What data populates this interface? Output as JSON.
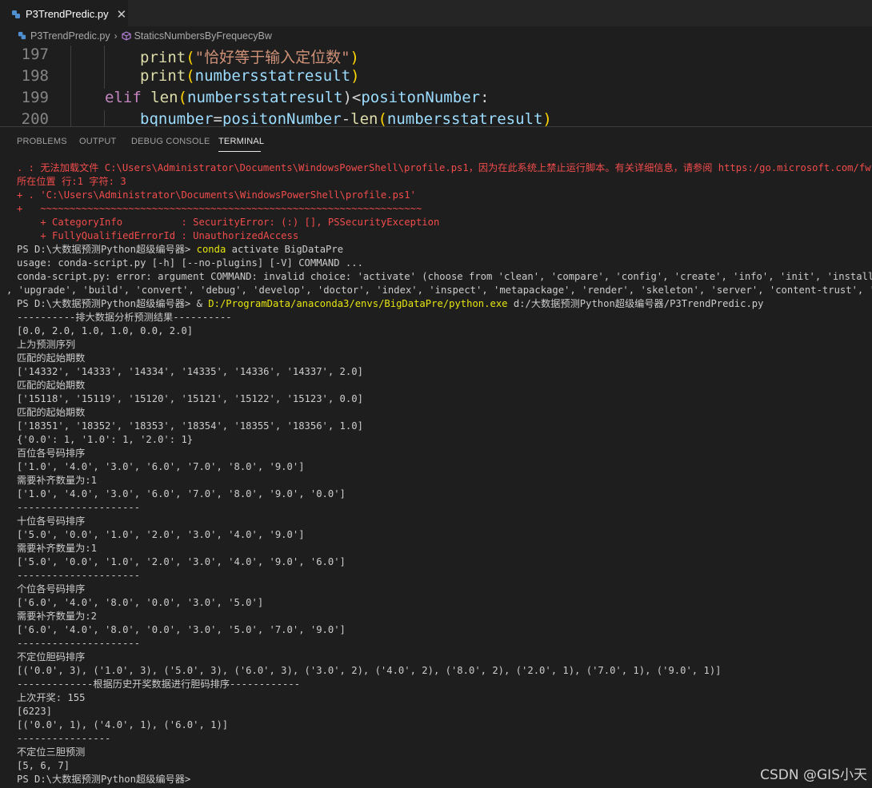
{
  "editor_tab": {
    "title": "P3TrendPredic.py"
  },
  "breadcrumb": {
    "file": "P3TrendPredic.py",
    "symbol": "StaticsNumbersByFrequecyBw"
  },
  "code_lines": [
    {
      "num": "197",
      "t1": "print",
      "t2": "(",
      "t3": "\"恰好等于输入定位数\"",
      "t4": ")"
    },
    {
      "num": "198",
      "t1": "print",
      "t2": "(",
      "t3": "numbersstatresult",
      "t4": ")"
    },
    {
      "num": "199",
      "t1": "elif",
      "t2": "len",
      "t3": "(",
      "t4": "numbersstatresult",
      "t5": ")<",
      "t6": "positonNumber",
      "t7": ":"
    },
    {
      "num": "200",
      "t1": "bqnumber",
      "t2": "=",
      "t3": "positonNumber",
      "t4": "-",
      "t5": "len",
      "t6": "(",
      "t7": "numbersstatresult",
      "t8": ")"
    }
  ],
  "panel_tabs": [
    "PROBLEMS",
    "OUTPUT",
    "DEBUG CONSOLE",
    "TERMINAL"
  ],
  "terminal": {
    "lines": [
      ". : 无法加载文件 C:\\Users\\Administrator\\Documents\\WindowsPowerShell\\profile.ps1，因为在此系统上禁止运行脚本。有关详细信息，请参阅 https:/go.microsoft.com/fw",
      "所在位置 行:1 字符: 3",
      "+ . 'C:\\Users\\Administrator\\Documents\\WindowsPowerShell\\profile.ps1'",
      "+   ~~~~~~~~~~~~~~~~~~~~~~~~~~~~~~~~~~~~~~~~~~~~~~~~~~~~~~~~~~~~~~~~~",
      "    + CategoryInfo          : SecurityError: (:) [], PSSecurityException",
      "    + FullyQualifiedErrorId : UnauthorizedAccess",
      "PS D:\\大数据预测Python超级编号器> ",
      "usage: conda-script.py [-h] [--no-plugins] [-V] COMMAND ...",
      "conda-script.py: error: argument COMMAND: invalid choice: 'activate' (choose from 'clean', 'compare', 'config', 'create', 'info', 'init', 'install', 'list'",
      ", 'upgrade', 'build', 'convert', 'debug', 'develop', 'doctor', 'index', 'inspect', 'metapackage', 'render', 'skeleton', 'server', 'content-trust', 'pack'",
      "PS D:\\大数据预测Python超级编号器> & ",
      "----------排大数据分析预测结果----------",
      "[0.0, 2.0, 1.0, 1.0, 0.0, 2.0]",
      "上为预测序列",
      "匹配的起始期数",
      "['14332', '14333', '14334', '14335', '14336', '14337', 2.0]",
      "匹配的起始期数",
      "['15118', '15119', '15120', '15121', '15122', '15123', 0.0]",
      "匹配的起始期数",
      "['18351', '18352', '18353', '18354', '18355', '18356', 1.0]",
      "{'0.0': 1, '1.0': 1, '2.0': 1}",
      "百位各号码排序",
      "['1.0', '4.0', '3.0', '6.0', '7.0', '8.0', '9.0']",
      "需要补齐数量为:1",
      "['1.0', '4.0', '3.0', '6.0', '7.0', '8.0', '9.0', '0.0']",
      "---------------------",
      "十位各号码排序",
      "['5.0', '0.0', '1.0', '2.0', '3.0', '4.0', '9.0']",
      "需要补齐数量为:1",
      "['5.0', '0.0', '1.0', '2.0', '3.0', '4.0', '9.0', '6.0']",
      "---------------------",
      "个位各号码排序",
      "['6.0', '4.0', '8.0', '0.0', '3.0', '5.0']",
      "需要补齐数量为:2",
      "['6.0', '4.0', '8.0', '0.0', '3.0', '5.0', '7.0', '9.0']",
      "---------------------",
      "不定位胆码排序",
      "[('0.0', 3), ('1.0', 3), ('5.0', 3), ('6.0', 3), ('3.0', 2), ('4.0', 2), ('8.0', 2), ('2.0', 1), ('7.0', 1), ('9.0', 1)]",
      "-------------根据历史开奖数据进行胆码排序------------",
      "上次开奖: 155",
      "[6223]",
      "[('0.0', 1), ('4.0', 1), ('6.0', 1)]",
      "----------------",
      "不定位三胆预测",
      "[5, 6, 7]",
      "PS D:\\大数据预测Python超级编号器>"
    ],
    "conda_cmd": "conda",
    "conda_args": " activate BigDataPre",
    "python_path": "D:/ProgramData/anaconda3/envs/BigDataPre/python.exe",
    "script_path": " d:/大数据预测Python超级编号器/P3TrendPredic.py"
  },
  "watermark": "CSDN @GIS小天",
  "colors": {
    "error": "#f14c4c",
    "command": "#e5e510",
    "background": "#1e1e1e"
  }
}
